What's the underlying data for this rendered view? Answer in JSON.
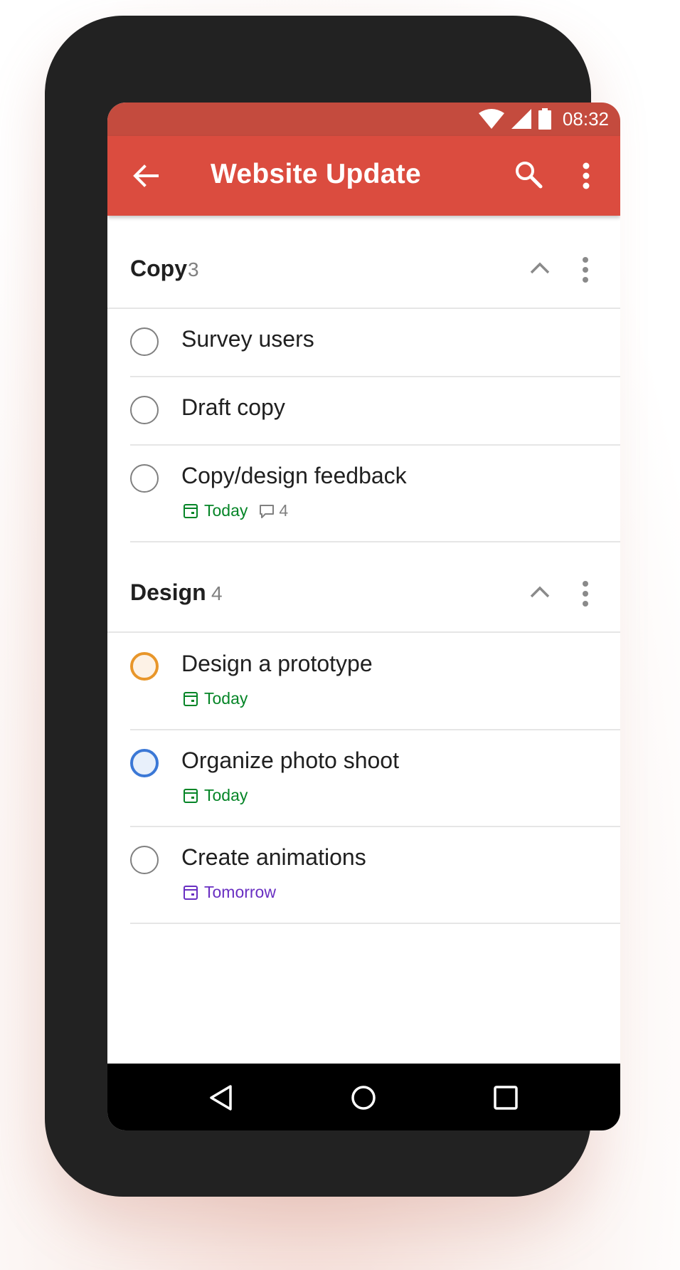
{
  "status": {
    "time": "08:32"
  },
  "appbar": {
    "title": "Website Update"
  },
  "sections": [
    {
      "name": "Copy",
      "count": "3",
      "tasks": [
        {
          "label": "Survey users",
          "priority": "none"
        },
        {
          "label": "Draft copy",
          "priority": "none"
        },
        {
          "label": "Copy/design feedback",
          "priority": "none",
          "date": "Today",
          "comments": "4"
        }
      ]
    },
    {
      "name": "Design",
      "count": "4",
      "tasks": [
        {
          "label": "Design a prototype",
          "priority": "p2",
          "date": "Today"
        },
        {
          "label": "Organize photo shoot",
          "priority": "p3",
          "date": "Today"
        },
        {
          "label": "Create animations",
          "priority": "none",
          "date": "Tomorrow"
        }
      ]
    }
  ],
  "colors": {
    "appbar": "#db4c3f",
    "statusbar": "#c44b3e",
    "today": "#058527",
    "tomorrow": "#692fc2",
    "priority2": "#e8962a",
    "priority3": "#3b78d6"
  },
  "icons": [
    "back-arrow-icon",
    "search-icon",
    "more-vert-icon",
    "chevron-up-icon",
    "calendar-icon",
    "comment-icon",
    "avatar",
    "nav-back-icon",
    "nav-home-icon",
    "nav-recents-icon"
  ]
}
